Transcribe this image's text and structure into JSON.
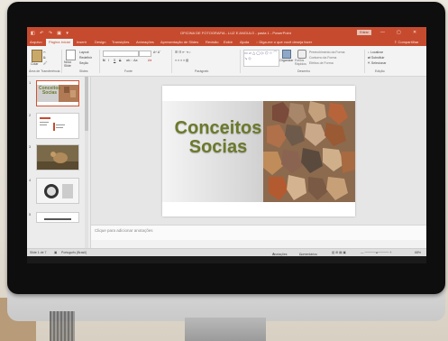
{
  "window": {
    "qat_icons": "◧ ↶ ↷ ▣ ▾",
    "title": "OFICINA DE FOTOGRAFIA - LUZ E ANGULO - pasta 1 - PowerPoint",
    "signin": "Entrar",
    "minimize": "—",
    "restore": "▢",
    "close": "✕"
  },
  "tabs": [
    "Arquivo",
    "Página Inicial",
    "Inserir",
    "Design",
    "Transições",
    "Animações",
    "Apresentação de Slides",
    "Revisão",
    "Exibir",
    "Ajuda"
  ],
  "tell_me": "Diga-me o que você deseja fazer",
  "share": "Compartilhar",
  "ribbon": {
    "clipboard": {
      "paste": "Colar",
      "label": "Área de Transferência"
    },
    "slides": {
      "new_slide": "Novo Slide",
      "layout": "Layout",
      "reset": "Redefinir",
      "section": "Seção",
      "label": "Slides"
    },
    "font": {
      "bold": "N",
      "italic": "I",
      "underline": "S",
      "strike": "S",
      "label": "Fonte"
    },
    "paragraph": {
      "label": "Parágrafo"
    },
    "drawing": {
      "arrange": "Organizar",
      "quick_styles": "Estilos Rápidos",
      "fill": "Preenchimento da Forma",
      "outline": "Contorno da Forma",
      "effects": "Efeitos de Forma",
      "label": "Desenho"
    },
    "editing": {
      "find": "Localizar",
      "replace": "Substituir",
      "select": "Selecionar",
      "label": "Edição"
    }
  },
  "shapes_preview": "▭ ▱ △ ◯ ▷ ⬠ ☆ ⌒ ↘ ◇",
  "slides": [
    {
      "num": "1",
      "title": "Conceitos Socias"
    },
    {
      "num": "2",
      "title": ""
    },
    {
      "num": "3",
      "title": ""
    },
    {
      "num": "4",
      "title": ""
    },
    {
      "num": "5",
      "title": ""
    }
  ],
  "main_slide": {
    "title": "Conceitos Socias"
  },
  "notes_placeholder": "Clique para adicionar anotações",
  "status": {
    "slide_counter": "Slide 1 de 7",
    "language": "Português (Brasil)",
    "notes": "Anotações",
    "comments": "Comentários",
    "zoom": "68%"
  },
  "colors": {
    "accent": "#c64b2e",
    "title_green": "#6b7a2b",
    "selected": "#d35230"
  }
}
